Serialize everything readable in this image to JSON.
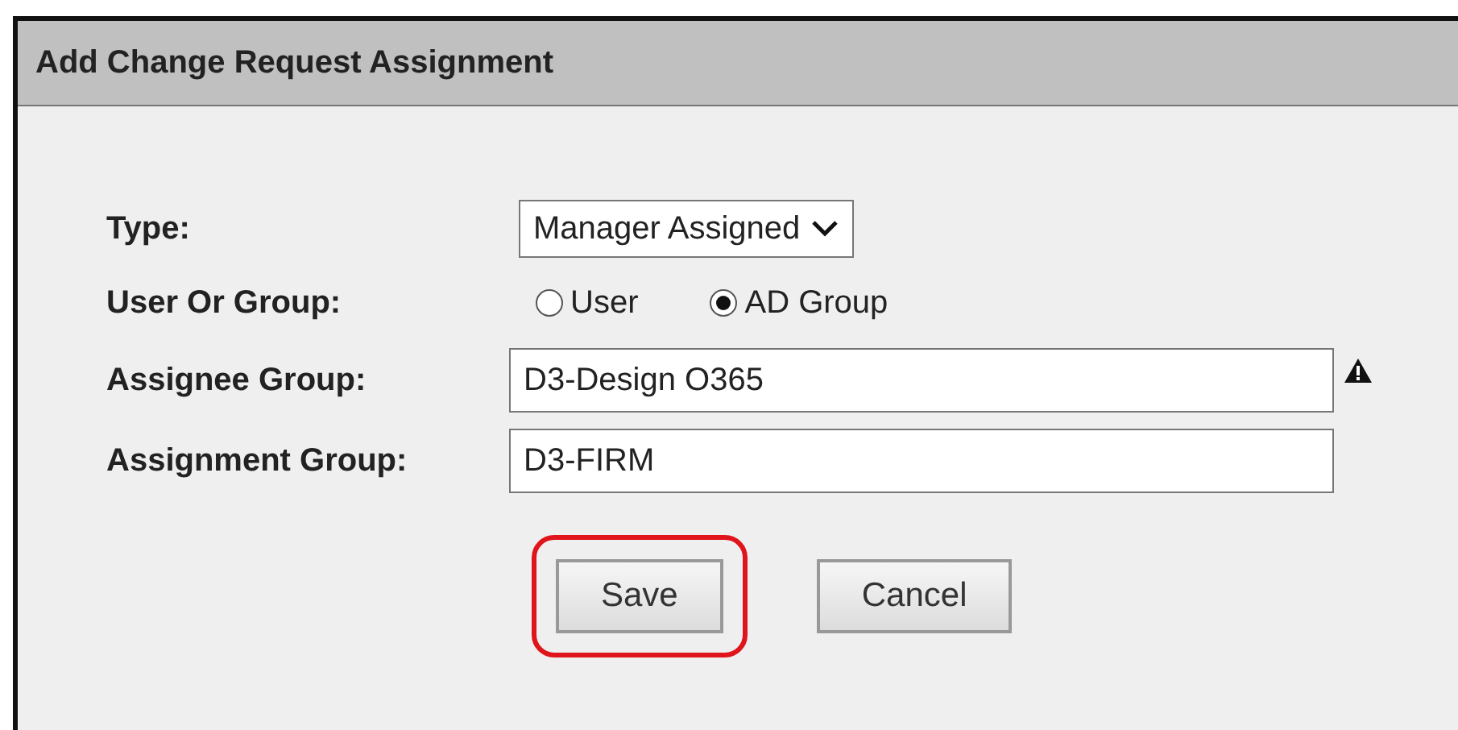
{
  "dialog": {
    "title": "Add Change Request Assignment"
  },
  "form": {
    "rows": [
      {
        "kind": "select",
        "label": "Type:",
        "value": "Manager Assigned"
      },
      {
        "kind": "radio",
        "label": "User Or Group:",
        "options": [
          {
            "label": "User",
            "selected": false
          },
          {
            "label": "AD Group",
            "selected": true
          }
        ]
      },
      {
        "kind": "text",
        "label": "Assignee Group:",
        "value": "D3-Design O365",
        "warning": true
      },
      {
        "kind": "text",
        "label": "Assignment Group:",
        "value": "D3-FIRM",
        "warning": false
      }
    ]
  },
  "buttons": [
    {
      "label": "Save",
      "highlighted": true
    },
    {
      "label": "Cancel",
      "highlighted": false
    }
  ]
}
